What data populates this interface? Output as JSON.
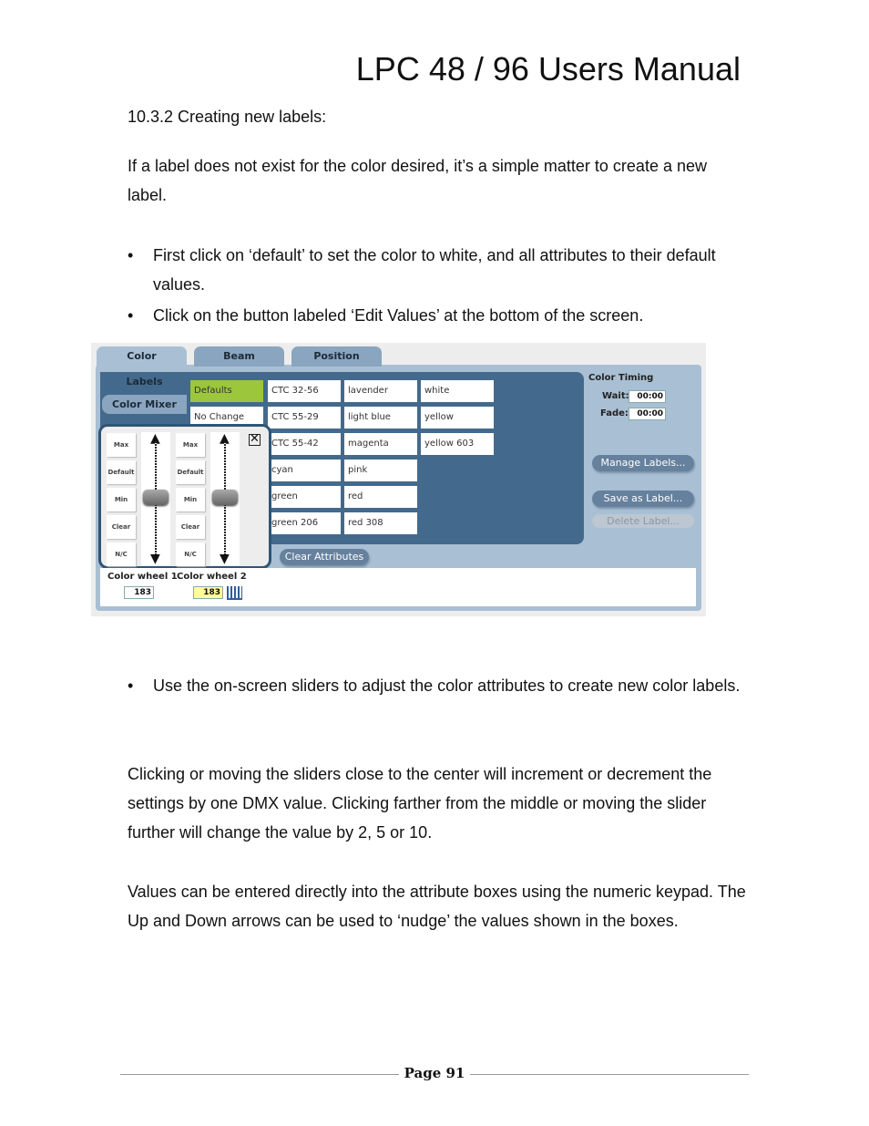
{
  "header": {
    "title": "LPC 48 / 96 Users Manual"
  },
  "section_heading": "10.3.2 Creating new labels:",
  "intro": "If a label does not exist for the color desired, it’s a simple matter to create a new label.",
  "bullets_top": [
    "First click on ‘default’ to set the color to white, and all attributes to their default values.",
    "Click on the button labeled ‘Edit Values’ at the bottom of the screen."
  ],
  "screenshot": {
    "tabs": [
      "Color",
      "Beam",
      "Position"
    ],
    "side_buttons": [
      "Labels",
      "Color Mixer"
    ],
    "label_grid": [
      [
        "Defaults",
        "CTC 32-56",
        "lavender",
        "white"
      ],
      [
        "No Change",
        "CTC 55-29",
        "light blue",
        "yellow"
      ],
      [
        "",
        "CTC 55-42",
        "magenta",
        "yellow 603"
      ],
      [
        "",
        "cyan",
        "pink",
        ""
      ],
      [
        "",
        "green",
        "red",
        ""
      ],
      [
        "",
        "green 206",
        "red 308",
        ""
      ]
    ],
    "selected_label": "Defaults",
    "slider_buttons": [
      "Max",
      "Default",
      "Min",
      "Clear",
      "N/C"
    ],
    "close_icon": "close-box-icon",
    "clear_attributes": "Clear Attributes",
    "attributes": [
      {
        "label": "Color wheel 1",
        "value": "183"
      },
      {
        "label": "Color wheel 2",
        "value": "183"
      }
    ],
    "timing": {
      "title": "Color Timing",
      "wait_label": "Wait:",
      "wait": "00:00",
      "fade_label": "Fade:",
      "fade": "00:00"
    },
    "buttons": {
      "manage": "Manage Labels...",
      "save": "Save as Label...",
      "delete": "Delete Label..."
    },
    "colors": {
      "panel": "#a9bfd4",
      "dark_panel": "#436a8c",
      "selected": "#9cc63b",
      "highlight_input": "#ffff99"
    }
  },
  "bullets_bottom": [
    "Use the on-screen sliders to adjust the color attributes to create new color labels."
  ],
  "para1": "Clicking or moving the sliders close to the center will increment or decrement the settings by one DMX value.  Clicking farther from the middle or moving the slider further will change the value by 2, 5 or 10.",
  "para2": "Values can be entered directly into the attribute boxes using the numeric keypad. The Up and Down arrows can be used to ‘nudge’ the values shown in the boxes.",
  "footer": {
    "page": "Page 91"
  }
}
